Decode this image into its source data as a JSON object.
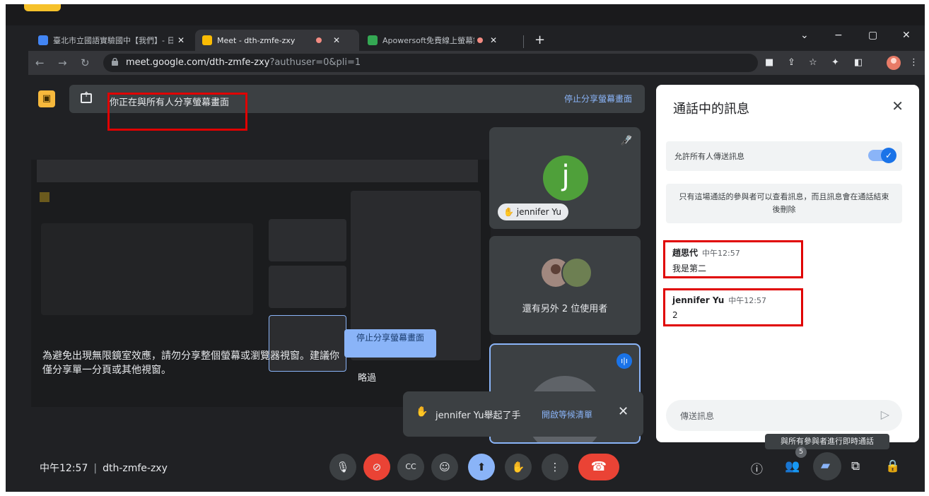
{
  "browser": {
    "tabs": [
      {
        "label": "臺北市立國語實驗國中【我們】- 日誌",
        "active": false
      },
      {
        "label": "Meet - dth-zmfe-zxy",
        "active": true
      },
      {
        "label": "Apowersoft免費線上螢幕錄",
        "active": false
      }
    ],
    "new_tab": "+",
    "url_main": "meet.google.com/dth-zmfe-zxy",
    "url_rest": "?authuser=0&pli=1"
  },
  "share_banner": {
    "message": "你正在與所有人分享螢幕畫面",
    "stop_label": "停止分享螢幕畫面"
  },
  "screenshare": {
    "warning": "為避免出現無限鏡室效應，請勿分享整個螢幕或瀏覽器視窗。建議你僅分享單一分頁或其他視窗。",
    "stop_button": "停止分享螢幕畫面",
    "skip": "略過"
  },
  "participants": {
    "tile1": {
      "initial": "j",
      "name": "jennifer Yu"
    },
    "tile2": {
      "caption": "還有另外 2 位使用者"
    }
  },
  "toast": {
    "text": "jennifer Yu舉起了手",
    "open_queue": "開啟等候清單"
  },
  "chat": {
    "title": "通話中的訊息",
    "allow_label": "允許所有人傳送訊息",
    "info": "只有這場通話的參與者可以查看訊息，而且訊息會在通話結束後刪除",
    "messages": [
      {
        "sender": "趙思代",
        "time": "中午12:57",
        "body": "我是第二"
      },
      {
        "sender": "jennifer Yu",
        "time": "中午12:57",
        "body": "2"
      }
    ],
    "composer_placeholder": "傳送訊息"
  },
  "tooltip": "與所有參與者進行即時通話",
  "footer": {
    "time": "中午12:57",
    "meeting_code": "dth-zmfe-zxy",
    "people_count": "5"
  }
}
